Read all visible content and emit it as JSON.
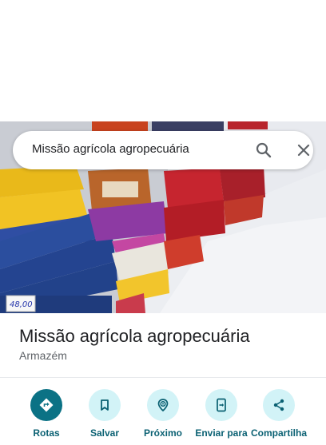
{
  "search": {
    "query": "Missão agrícola agropecuária"
  },
  "photo": {
    "price_tag": "48,00"
  },
  "place": {
    "title": "Missão agrícola agropecuária",
    "category": "Armazém"
  },
  "actions": [
    {
      "label": "Rotas",
      "icon": "directions-icon"
    },
    {
      "label": "Salvar",
      "icon": "bookmark-icon"
    },
    {
      "label": "Próximo",
      "icon": "nearby-icon"
    },
    {
      "label": "Enviar para",
      "icon": "send-to-phone-icon"
    },
    {
      "label": "Compartilha",
      "icon": "share-icon"
    }
  ],
  "colors": {
    "primary_action": "#0b7285",
    "action_bg": "#d2f3f7",
    "action_label": "#0b6173"
  }
}
